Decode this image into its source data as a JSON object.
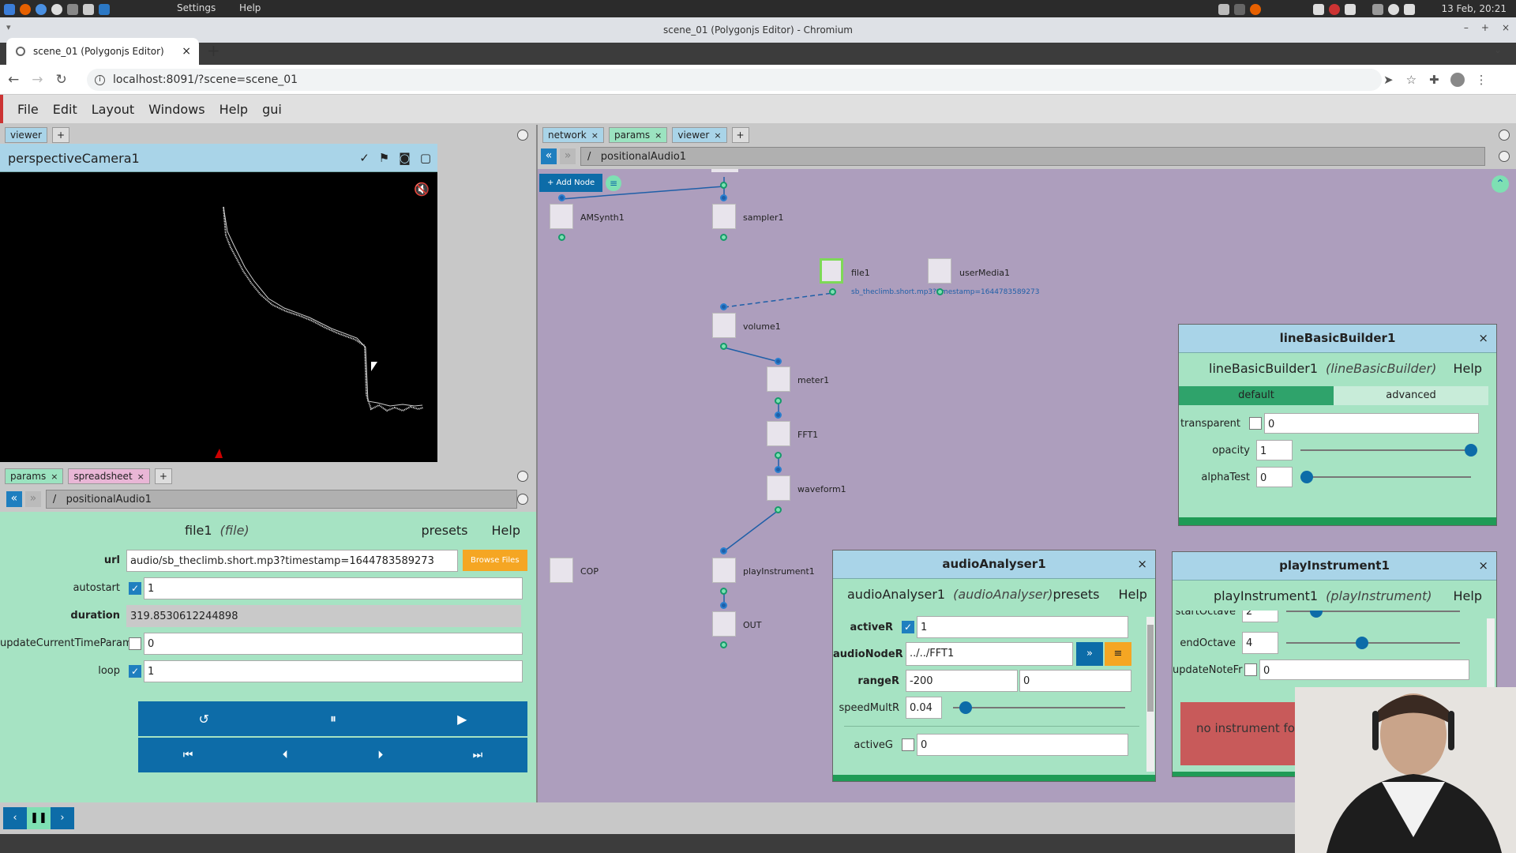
{
  "os": {
    "menu": [
      "Settings",
      "Help"
    ],
    "datetime": "13 Feb, 20:21"
  },
  "browser": {
    "window_title": "scene_01 (Polygonjs Editor) - Chromium",
    "tab_title": "scene_01 (Polygonjs Editor)",
    "url": "localhost:8091/?scene=scene_01"
  },
  "menubar": [
    "File",
    "Edit",
    "Layout",
    "Windows",
    "Help",
    "gui"
  ],
  "viewer": {
    "tabs": [
      "viewer"
    ],
    "camera_name": "perspectiveCamera1"
  },
  "params_panel": {
    "tabs": [
      "params",
      "spreadsheet"
    ],
    "path": "positionalAudio1",
    "node_name": "file1",
    "node_type": "(file)",
    "presets": "presets",
    "help": "Help",
    "rows": [
      {
        "label": "url",
        "value": "audio/sb_theclimb.short.mp3?timestamp=1644783589273",
        "button": "Browse Files"
      },
      {
        "label": "autostart",
        "checked": true,
        "value": "1"
      },
      {
        "label": "duration",
        "value": "319.8530612244898"
      },
      {
        "label": "updateCurrentTimeParam",
        "checked": false,
        "value": "0"
      },
      {
        "label": "loop",
        "checked": true,
        "value": "1"
      }
    ]
  },
  "network": {
    "tabs": [
      "network",
      "params",
      "viewer"
    ],
    "path": "positionalAudio1",
    "add_node": "+ Add Node",
    "nodes": [
      "AMSynth1",
      "sampler1",
      "file1",
      "userMedia1",
      "volume1",
      "meter1",
      "FFT1",
      "waveform1",
      "COP",
      "playInstrument1",
      "OUT"
    ],
    "file_hint": "sb_theclimb.short.mp3?timestamp=1644783589273"
  },
  "lineBasicBuilder": {
    "title": "lineBasicBuilder1",
    "node_name": "lineBasicBuilder1",
    "node_type": "(lineBasicBuilder)",
    "help": "Help",
    "tabs": [
      "default",
      "advanced"
    ],
    "rows": [
      {
        "label": "transparent",
        "checked": false,
        "value": "0"
      },
      {
        "label": "opacity",
        "value": "1",
        "slider": 1.0
      },
      {
        "label": "alphaTest",
        "value": "0",
        "slider": 0.0
      }
    ]
  },
  "audioAnalyser": {
    "title": "audioAnalyser1",
    "node_name": "audioAnalyser1",
    "node_type": "(audioAnalyser)",
    "presets": "presets",
    "help": "Help",
    "rows": [
      {
        "label": "activeR",
        "checked": true,
        "value": "1"
      },
      {
        "label": "audioNodeR",
        "value": "../../FFT1"
      },
      {
        "label": "rangeR",
        "value": "-200",
        "value2": "0"
      },
      {
        "label": "speedMultR",
        "value": "0.04",
        "slider": 0.05
      },
      {
        "label": "activeG",
        "checked": false,
        "value": "0"
      }
    ]
  },
  "playInstrument": {
    "title": "playInstrument1",
    "node_name": "playInstrument1",
    "node_type": "(playInstrument)",
    "help": "Help",
    "rows": [
      {
        "label": "startOctave",
        "value": "2",
        "slider": 0.15
      },
      {
        "label": "endOctave",
        "value": "4",
        "slider": 0.4
      },
      {
        "label": "updateNoteFr",
        "checked": false,
        "value": "0"
      }
    ],
    "message": "no instrument found"
  }
}
